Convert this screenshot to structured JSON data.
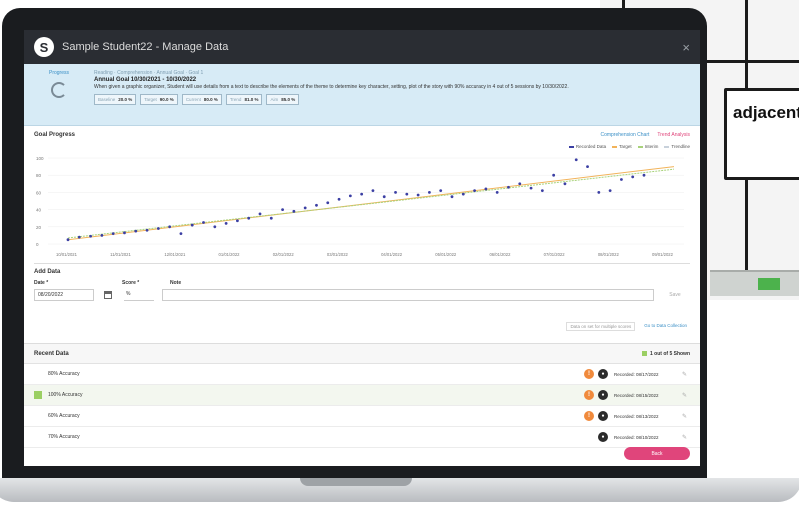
{
  "window": {
    "title": "Sample Student22 - Manage Data",
    "logo": "S",
    "close": "×"
  },
  "poster": {
    "word": "adjacent"
  },
  "goal": {
    "ring_label": "Progress",
    "breadcrumb": "Reading · Comprehension · Annual Goal · Goal 1",
    "annual_label": "Annual Goal",
    "dates": "10/30/2021 - 10/30/2022",
    "description": "When given a graphic organizer, Student will use details from a text to describe the elements of the theme to determine key character, setting, plot of the story with 90% accuracy in 4 out of 5 sessions by 10/30/2022.",
    "chips": [
      {
        "k": "Baseline",
        "v": "20.0 %"
      },
      {
        "k": "Target",
        "v": "90.0 %"
      },
      {
        "k": "Current",
        "v": "80.0 %"
      },
      {
        "k": "Trend",
        "v": "81.0 %"
      },
      {
        "k": "Aim",
        "v": "85.0 %"
      }
    ]
  },
  "goal_progress": {
    "heading": "Goal Progress",
    "link_a": "Comprehension Chart",
    "link_b": "Trend Analysis",
    "legend": [
      "Recorded Data",
      "Target",
      "Interim",
      "Trendline"
    ]
  },
  "add_data": {
    "heading": "Add Data",
    "date_label": "Date *",
    "score_label": "Score *",
    "note_label": "Note",
    "date_value": "08/20/2022",
    "score_value": "%",
    "save": "Save",
    "link1": "Data on set for multiple scores",
    "link2": "Go to Data Collection"
  },
  "recent": {
    "heading": "Recent Data",
    "count": "1 out of 5 Shown",
    "rows": [
      {
        "name": "80% Accuracy",
        "rec": "Recorded: 08/17/2022",
        "marker": "none",
        "orange": true
      },
      {
        "name": "100% Accuracy",
        "rec": "Recorded: 08/15/2022",
        "marker": "green",
        "orange": true
      },
      {
        "name": "60% Accuracy",
        "rec": "Recorded: 08/13/2022",
        "marker": "none",
        "orange": true
      },
      {
        "name": "70% Accuracy",
        "rec": "Recorded: 08/10/2022",
        "marker": "none",
        "orange": false
      }
    ],
    "back": "Back"
  },
  "colors": {
    "accent": "#e0457b",
    "link": "#3a8fc6",
    "titlebar": "#2a2d33",
    "banner": "#d7ebf6"
  },
  "chart_data": {
    "type": "scatter",
    "x_labels": [
      "10/01/2021",
      "11/01/2021",
      "12/01/2021",
      "01/01/2022",
      "02/01/2022",
      "03/01/2022",
      "04/01/2022",
      "05/01/2022",
      "06/01/2022",
      "07/01/2022",
      "08/01/2022",
      "09/01/2022"
    ],
    "y_ticks": [
      0,
      20,
      40,
      60,
      80,
      100
    ],
    "ylim": [
      0,
      100
    ],
    "series": [
      {
        "name": "Recorded Data",
        "values": [
          5,
          8,
          9,
          10,
          12,
          13,
          15,
          16,
          18,
          20,
          12,
          22,
          25,
          20,
          24,
          27,
          30,
          35,
          30,
          40,
          38,
          42,
          45,
          48,
          52,
          56,
          58,
          62,
          55,
          60,
          58,
          57,
          60,
          62,
          55,
          58,
          62,
          64,
          60,
          66,
          70,
          65,
          62,
          80,
          70,
          98,
          90,
          60,
          62,
          75,
          78,
          80
        ]
      },
      {
        "name": "Trendline",
        "values": [
          5,
          90
        ]
      }
    ]
  }
}
